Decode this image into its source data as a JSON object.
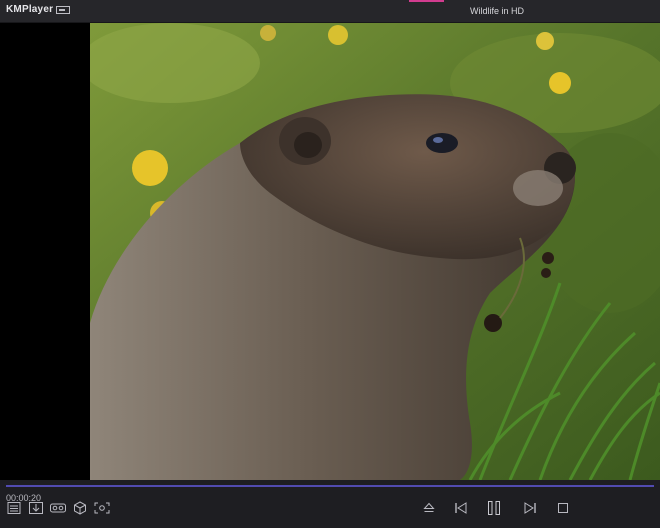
{
  "app": {
    "name": "KMPlayer"
  },
  "video": {
    "title": "Wildlife in HD"
  },
  "playback": {
    "time": "00:00:20",
    "progress_fraction": 0.0
  },
  "colors": {
    "accent": "#5b54c9",
    "title_accent": "#d23c8f",
    "background": "#1c1c1f"
  },
  "icons": {
    "menu": "menu-icon",
    "left_controls": [
      "playlist-icon",
      "download-icon",
      "vr-icon",
      "3d-cube-icon",
      "screen-capture-icon"
    ],
    "right_controls": [
      "eject-icon",
      "skip-previous-icon",
      "pause-icon",
      "skip-next-icon",
      "stop-icon"
    ]
  }
}
